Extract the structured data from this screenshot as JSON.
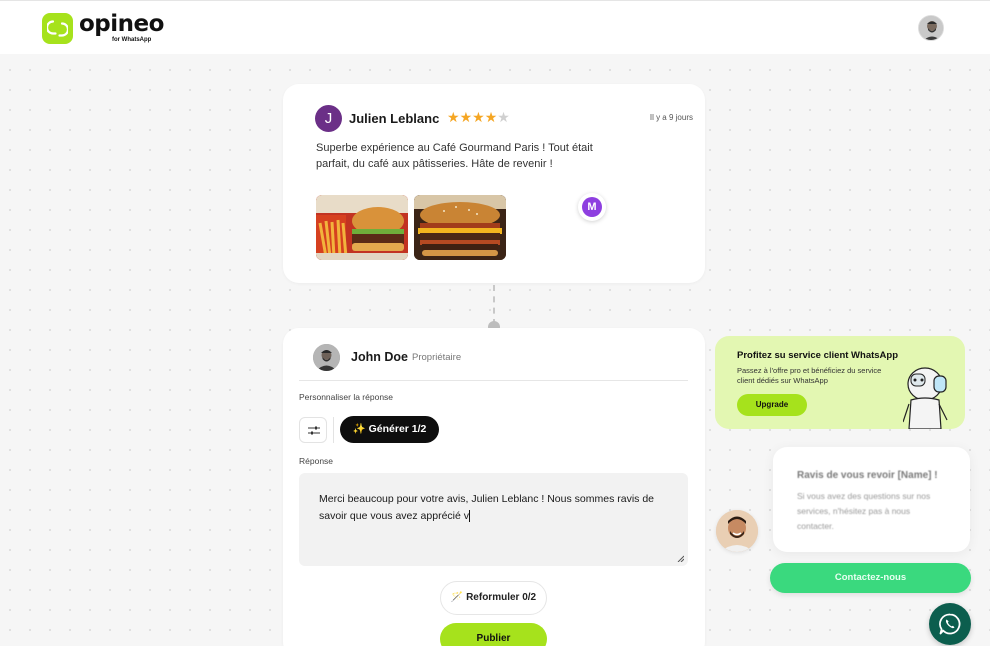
{
  "header": {
    "logo_text": "opineo",
    "logo_subtitle": "for WhatsApp"
  },
  "review": {
    "reviewer_initial": "J",
    "reviewer_name": "Julien Leblanc",
    "rating": 4,
    "rating_max": 5,
    "date": "Il y a 9 jours",
    "text": "Superbe expérience au Café Gourmand Paris ! Tout était parfait, du café aux pâtisseries. Hâte de revenir !",
    "photos": [
      "burger-and-fries-photo",
      "bacon-burger-photo"
    ],
    "floating_badge_initial": "M"
  },
  "reply": {
    "owner_name": "John Doe",
    "owner_role": "Propriétaire",
    "customize_label": "Personnaliser la réponse",
    "generate_label": "✨ Générer 1/2",
    "response_label": "Réponse",
    "response_text": "Merci beaucoup pour votre avis, Julien Leblanc ! Nous sommes ravis de savoir que vous avez apprécié v",
    "reformulate_label": "🪄 Reformuler 0/2",
    "publish_label": "Publier"
  },
  "promo": {
    "title": "Profitez su service client WhatsApp",
    "text": "Passez à l'offre pro et bénéficiez du service client dédiés sur WhatsApp",
    "button_label": "Upgrade"
  },
  "chat": {
    "title": "Ravis de vous revoir [Name] !",
    "text": "Si vous avez des questions sur nos services, n'hésitez pas à nous contacter.",
    "contact_label": "Contactez-nous"
  },
  "colors": {
    "brand_green": "#a6e21c",
    "whatsapp_green": "#3ad97e",
    "whatsapp_dark": "#0c5e4e",
    "star": "#f5a623",
    "reviewer_avatar": "#6b2f87",
    "badge_purple": "#8e3fe0"
  }
}
